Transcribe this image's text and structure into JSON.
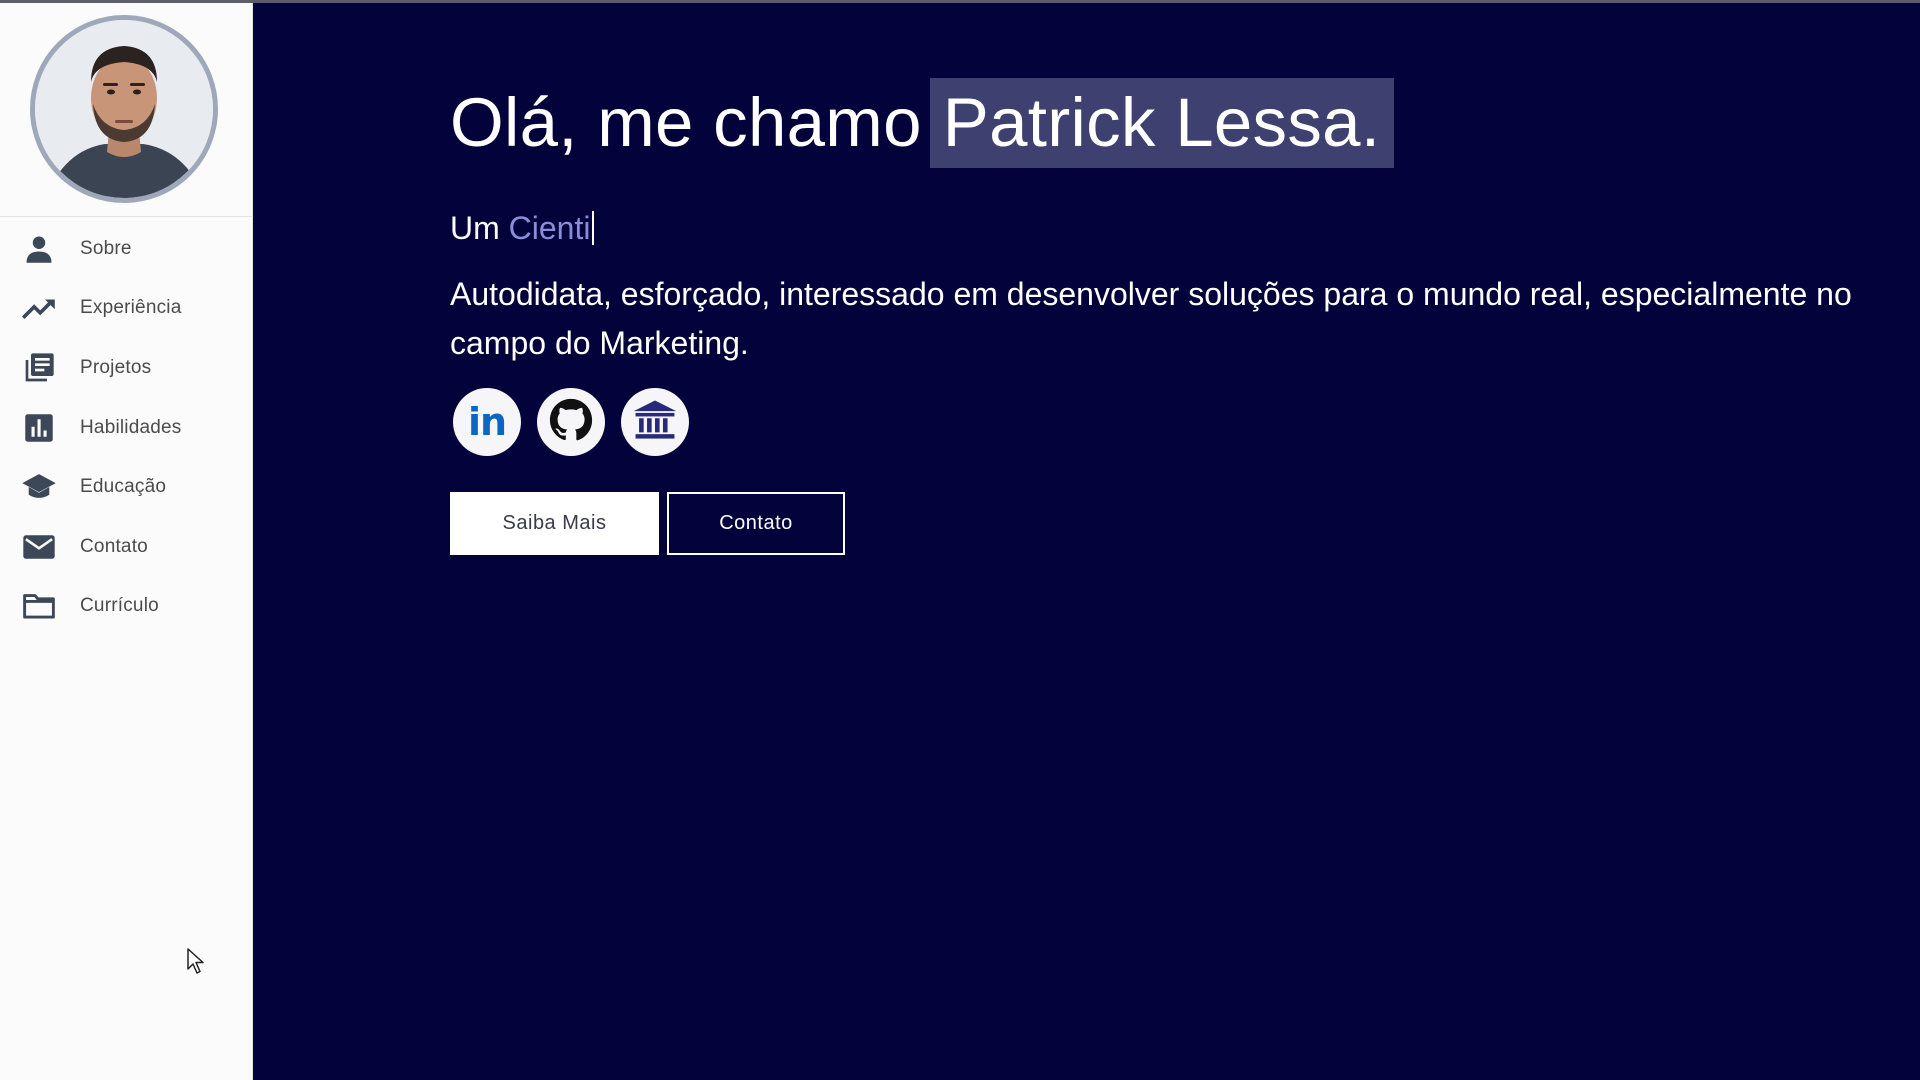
{
  "sidebar": {
    "items": [
      {
        "label": "Sobre",
        "icon": "person-icon"
      },
      {
        "label": "Experiência",
        "icon": "trending-up-icon"
      },
      {
        "label": "Projetos",
        "icon": "library-books-icon"
      },
      {
        "label": "Habilidades",
        "icon": "bar-chart-icon"
      },
      {
        "label": "Educação",
        "icon": "graduation-cap-icon"
      },
      {
        "label": "Contato",
        "icon": "mail-icon"
      },
      {
        "label": "Currículo",
        "icon": "folder-icon"
      }
    ]
  },
  "hero": {
    "greeting": "Olá, me chamo",
    "name": "Patrick Lessa.",
    "subtitle_prefix": "Um",
    "subtitle_role": "Cienti",
    "description": "Autodidata, esforçado, interessado em desenvolver soluções para o mundo real, especialmente no campo do Marketing.",
    "social": [
      {
        "icon": "linkedin-icon",
        "text": "in"
      },
      {
        "icon": "github-icon"
      },
      {
        "icon": "institution-icon"
      }
    ],
    "buttons": {
      "primary": "Saiba Mais",
      "secondary": "Contato"
    }
  },
  "colors": {
    "background": "#03023a",
    "sidebar": "#fbfbfb",
    "name_highlight": "#3e4170",
    "role_text": "#8a8ed8",
    "linkedin_blue": "#0a66c2",
    "institution_navy": "#272a7a"
  }
}
